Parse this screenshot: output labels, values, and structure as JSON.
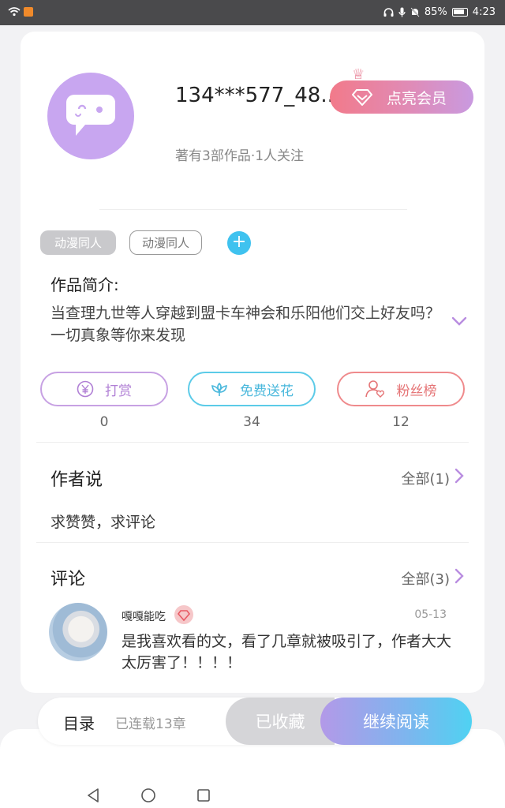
{
  "status_bar": {
    "battery": "85%",
    "time": "4:23"
  },
  "author": {
    "name": "134***577_48...",
    "works_info": "著有3部作品·1人关注",
    "vip_label": "点亮会员"
  },
  "tags": [
    "动漫同人",
    "动漫同人"
  ],
  "add_tag_symbol": "+",
  "intro": {
    "title": "作品简介:",
    "text": "当查理九世等人穿越到盟卡车神会和乐阳他们交上好友吗？一切真象等你来发现"
  },
  "actions": [
    {
      "label": "打赏",
      "count": "0",
      "icon": "yen-icon",
      "color": "#b07fd5"
    },
    {
      "label": "免费送花",
      "count": "34",
      "icon": "flower-icon",
      "color": "#4ab8dc"
    },
    {
      "label": "粉丝榜",
      "count": "12",
      "icon": "fan-icon",
      "color": "#e57476"
    }
  ],
  "author_says": {
    "title": "作者说",
    "all": "全部(1)",
    "text": "求赞赞，求评论"
  },
  "comments": {
    "title": "评论",
    "all": "全部(3)",
    "items": [
      {
        "user": "嘎嘎能吃",
        "date": "05-13",
        "text": "是我喜欢看的文，看了几章就被吸引了，作者大大太厉害了！！！！"
      }
    ]
  },
  "bottom": {
    "toc": "目录",
    "serial": "已连载13章",
    "collected": "已收藏",
    "continue": "继续阅读"
  },
  "colors": {
    "accent_purple": "#c8a6f0",
    "accent_blue": "#3fc2ef",
    "vip_pink": "#f27a8a"
  }
}
